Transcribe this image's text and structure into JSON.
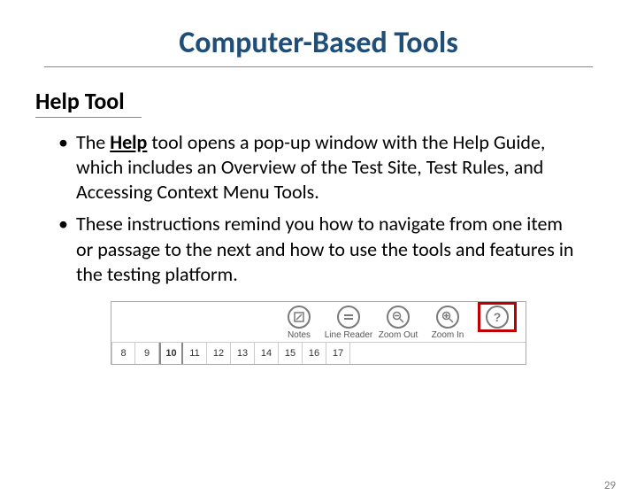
{
  "title": "Computer-Based Tools",
  "subtitle": "Help Tool",
  "bullets": {
    "b1_pre": "The ",
    "b1_help": "Help",
    "b1_post": " tool opens a pop-up window with the Help Guide, which includes an Overview of the Test Site, Test Rules, and Accessing Context Menu Tools.",
    "b2": "These instructions remind you how to navigate from one item or passage to the next and how to use the tools and features in the testing platform."
  },
  "toolbar": {
    "tools": {
      "notes": "Notes",
      "line_reader": "Line Reader",
      "zoom_out": "Zoom Out",
      "zoom_in": "Zoom In"
    },
    "help_glyph": "?",
    "numbers": [
      "8",
      "9",
      "10",
      "11",
      "12",
      "13",
      "14",
      "15",
      "16",
      "17"
    ],
    "active_index": 2
  },
  "page_number": "29"
}
